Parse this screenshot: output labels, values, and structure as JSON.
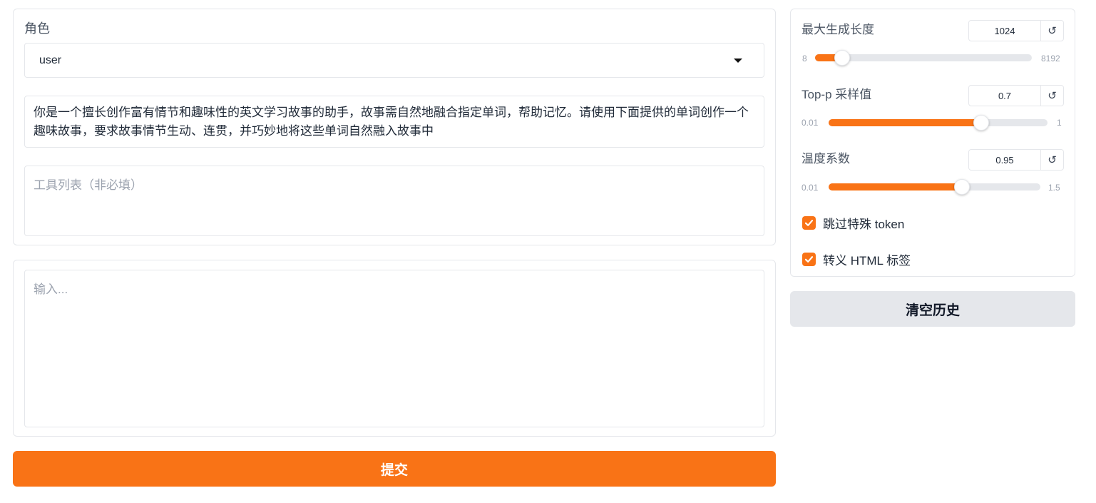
{
  "role": {
    "label": "角色",
    "selected": "user"
  },
  "system_prompt": "你是一个擅长创作富有情节和趣味性的英文学习故事的助手，故事需自然地融合指定单词，帮助记忆。请使用下面提供的单词创作一个趣味故事，要求故事情节生动、连贯，并巧妙地将这些单词自然融入故事中",
  "tools": {
    "placeholder": "工具列表（非必填）"
  },
  "input": {
    "placeholder": "输入..."
  },
  "submit_label": "提交",
  "settings": {
    "max_length": {
      "label": "最大生成长度",
      "value": "1024",
      "min": "8",
      "max": "8192",
      "fraction": 0.124
    },
    "top_p": {
      "label": "Top-p 采样值",
      "value": "0.7",
      "min": "0.01",
      "max": "1",
      "fraction": 0.697
    },
    "temperature": {
      "label": "温度系数",
      "value": "0.95",
      "min": "0.01",
      "max": "1.5",
      "fraction": 0.631
    },
    "reset_symbol": "↺"
  },
  "checkboxes": {
    "skip_special_tokens": {
      "label": "跳过特殊 token",
      "checked": true
    },
    "escape_html": {
      "label": "转义 HTML 标签",
      "checked": true
    }
  },
  "clear_label": "清空历史",
  "colors": {
    "accent": "#f97316",
    "secondary_button": "#e5e7eb"
  }
}
